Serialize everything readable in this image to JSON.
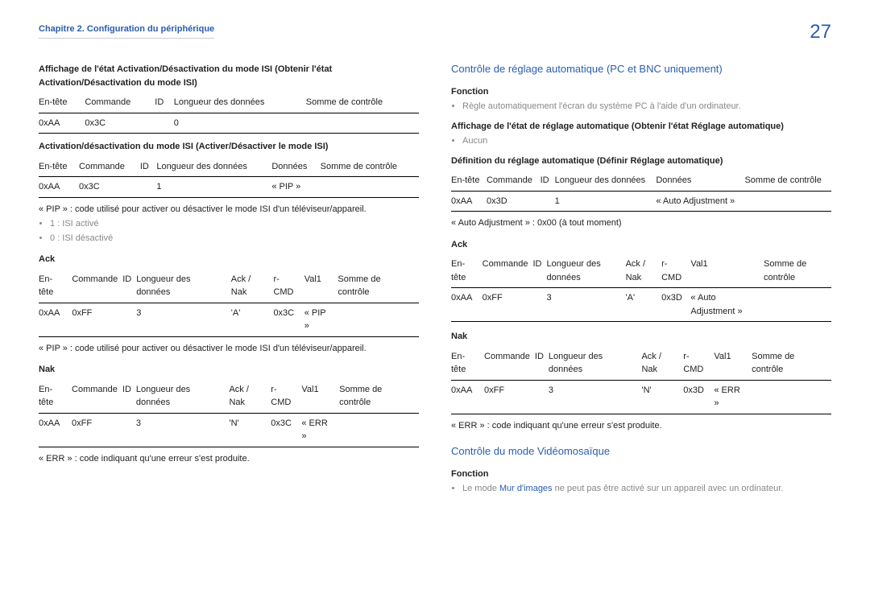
{
  "header": {
    "chapter": "Chapitre 2. Configuration du périphérique",
    "page_number": "27"
  },
  "left": {
    "section1_title": "Affichage de l'état Activation/Désactivation du mode ISI (Obtenir l'état Activation/Désactivation du mode ISI)",
    "table1": {
      "headers": [
        "En-tête",
        "Commande",
        "ID",
        "Longueur des données",
        "Somme de contrôle"
      ],
      "rows": [
        [
          "0xAA",
          "0x3C",
          "",
          "0",
          ""
        ]
      ]
    },
    "section2_title": "Activation/désactivation du mode ISI (Activer/Désactiver le mode ISI)",
    "table2": {
      "headers": [
        "En-tête",
        "Commande",
        "ID",
        "Longueur des données",
        "Données",
        "Somme de contrôle"
      ],
      "rows": [
        [
          "0xAA",
          "0x3C",
          "",
          "1",
          "« PIP »",
          ""
        ]
      ]
    },
    "pip_note": "« PIP » : code utilisé pour activer ou désactiver le mode ISI d'un téléviseur/appareil.",
    "pip_bullets": [
      "1 : ISI activé",
      "0 : ISI désactivé"
    ],
    "ack_label": "Ack",
    "table_ack": {
      "headers": [
        "En-tête",
        "Commande",
        "ID",
        "Longueur des données",
        "Ack / Nak",
        "r-CMD",
        "Val1",
        "Somme de contrôle"
      ],
      "rows": [
        [
          "0xAA",
          "0xFF",
          "",
          "3",
          "'A'",
          "0x3C",
          "« PIP »",
          ""
        ]
      ]
    },
    "pip_note2": "« PIP » : code utilisé pour activer ou désactiver le mode ISI d'un téléviseur/appareil.",
    "nak_label": "Nak",
    "table_nak": {
      "headers": [
        "En-tête",
        "Commande",
        "ID",
        "Longueur des données",
        "Ack / Nak",
        "r-CMD",
        "Val1",
        "Somme de contrôle"
      ],
      "rows": [
        [
          "0xAA",
          "0xFF",
          "",
          "3",
          "'N'",
          "0x3C",
          "« ERR »",
          ""
        ]
      ]
    },
    "err_note": "« ERR » : code indiquant qu'une erreur s'est produite."
  },
  "right": {
    "blue_title1": "Contrôle de réglage automatique (PC et BNC uniquement)",
    "fonction_label": "Fonction",
    "fonction_bullet": "Règle automatiquement l'écran du système PC à l'aide d'un ordinateur.",
    "sub1": "Affichage de l'état de réglage automatique (Obtenir l'état Réglage automatique)",
    "sub1_bullet": "Aucun",
    "sub2": "Définition du réglage automatique (Définir Réglage automatique)",
    "table_def": {
      "headers": [
        "En-tête",
        "Commande",
        "ID",
        "Longueur des données",
        "Données",
        "Somme de contrôle"
      ],
      "rows": [
        [
          "0xAA",
          "0x3D",
          "",
          "1",
          "« Auto Adjustment »",
          ""
        ]
      ]
    },
    "auto_note": "« Auto Adjustment » : 0x00 (à tout moment)",
    "ack_label": "Ack",
    "table_ack": {
      "headers": [
        "En-tête",
        "Commande",
        "ID",
        "Longueur des données",
        "Ack / Nak",
        "r-CMD",
        "Val1",
        "Somme de contrôle"
      ],
      "rows": [
        [
          "0xAA",
          "0xFF",
          "",
          "3",
          "'A'",
          "0x3D",
          "« Auto Adjustment »",
          ""
        ]
      ]
    },
    "nak_label": "Nak",
    "table_nak": {
      "headers": [
        "En-tête",
        "Commande",
        "ID",
        "Longueur des données",
        "Ack / Nak",
        "r-CMD",
        "Val1",
        "Somme de contrôle"
      ],
      "rows": [
        [
          "0xAA",
          "0xFF",
          "",
          "3",
          "'N'",
          "0x3D",
          "« ERR »",
          ""
        ]
      ]
    },
    "err_note": "« ERR » : code indiquant qu'une erreur s'est produite.",
    "blue_title2": "Contrôle du mode Vidéomosaïque",
    "fonction2_label": "Fonction",
    "fonction2_bullet_prefix": "Le mode ",
    "fonction2_link": "Mur d'images",
    "fonction2_bullet_suffix": " ne peut pas être activé sur un appareil avec un ordinateur."
  }
}
